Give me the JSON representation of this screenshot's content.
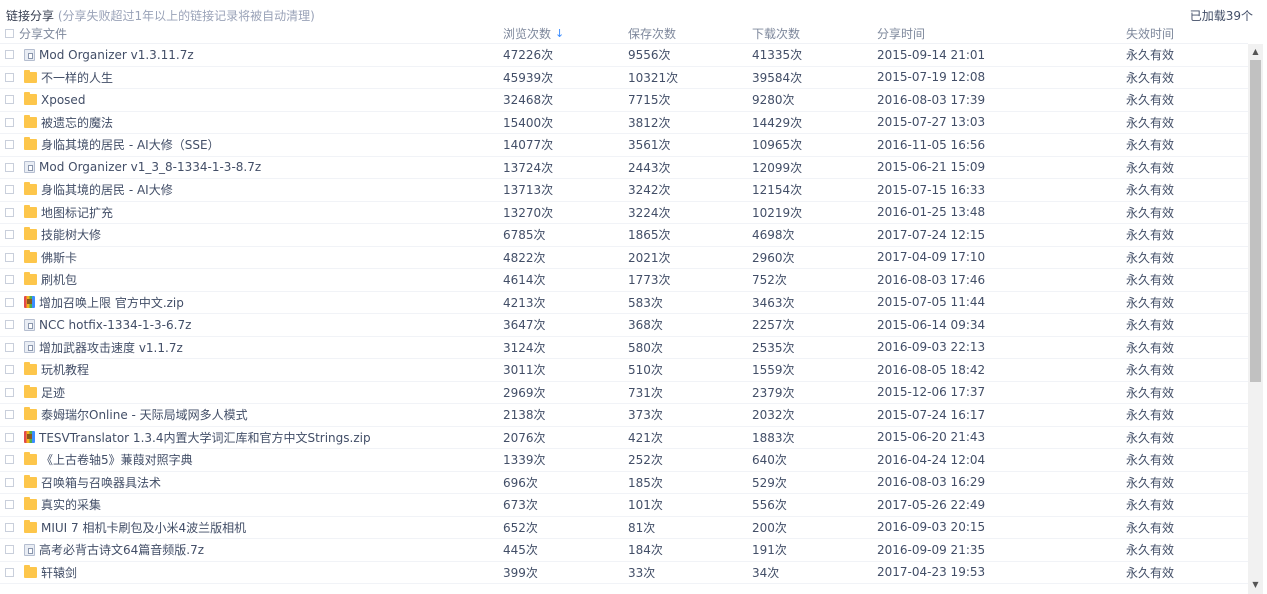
{
  "header": {
    "title": "链接分享",
    "note": "(分享失败超过1年以上的链接记录将被自动清理)",
    "loaded": "已加载39个"
  },
  "columns": {
    "name": "分享文件",
    "views": "浏览次数",
    "views_sort_icon": "arrow-down",
    "saves": "保存次数",
    "downloads": "下载次数",
    "time": "分享时间",
    "status": "失效时间"
  },
  "rows": [
    {
      "icon": "file-7z",
      "name": "Mod Organizer v1.3.11.7z",
      "views": "47226次",
      "saves": "9556次",
      "downloads": "41335次",
      "time": "2015-09-14 21:01",
      "status": "永久有效"
    },
    {
      "icon": "folder",
      "name": "不一样的人生",
      "views": "45939次",
      "saves": "10321次",
      "downloads": "39584次",
      "time": "2015-07-19 12:08",
      "status": "永久有效"
    },
    {
      "icon": "folder",
      "name": "Xposed",
      "views": "32468次",
      "saves": "7715次",
      "downloads": "9280次",
      "time": "2016-08-03 17:39",
      "status": "永久有效"
    },
    {
      "icon": "folder",
      "name": "被遗忘的魔法",
      "views": "15400次",
      "saves": "3812次",
      "downloads": "14429次",
      "time": "2015-07-27 13:03",
      "status": "永久有效"
    },
    {
      "icon": "folder",
      "name": "身临其境的居民 - AI大修（SSE）",
      "views": "14077次",
      "saves": "3561次",
      "downloads": "10965次",
      "time": "2016-11-05 16:56",
      "status": "永久有效"
    },
    {
      "icon": "file-7z",
      "name": "Mod Organizer v1_3_8-1334-1-3-8.7z",
      "views": "13724次",
      "saves": "2443次",
      "downloads": "12099次",
      "time": "2015-06-21 15:09",
      "status": "永久有效"
    },
    {
      "icon": "folder",
      "name": "身临其境的居民 - AI大修",
      "views": "13713次",
      "saves": "3242次",
      "downloads": "12154次",
      "time": "2015-07-15 16:33",
      "status": "永久有效"
    },
    {
      "icon": "folder",
      "name": "地图标记扩充",
      "views": "13270次",
      "saves": "3224次",
      "downloads": "10219次",
      "time": "2016-01-25 13:48",
      "status": "永久有效"
    },
    {
      "icon": "folder",
      "name": "技能树大修",
      "views": "6785次",
      "saves": "1865次",
      "downloads": "4698次",
      "time": "2017-07-24 12:15",
      "status": "永久有效"
    },
    {
      "icon": "folder",
      "name": "佛斯卡",
      "views": "4822次",
      "saves": "2021次",
      "downloads": "2960次",
      "time": "2017-04-09 17:10",
      "status": "永久有效"
    },
    {
      "icon": "folder",
      "name": "刷机包",
      "views": "4614次",
      "saves": "1773次",
      "downloads": "752次",
      "time": "2016-08-03 17:46",
      "status": "永久有效"
    },
    {
      "icon": "zip",
      "name": "增加召唤上限 官方中文.zip",
      "views": "4213次",
      "saves": "583次",
      "downloads": "3463次",
      "time": "2015-07-05 11:44",
      "status": "永久有效"
    },
    {
      "icon": "file-7z",
      "name": "NCC hotfix-1334-1-3-6.7z",
      "views": "3647次",
      "saves": "368次",
      "downloads": "2257次",
      "time": "2015-06-14 09:34",
      "status": "永久有效"
    },
    {
      "icon": "file-7z",
      "name": "增加武器攻击速度 v1.1.7z",
      "views": "3124次",
      "saves": "580次",
      "downloads": "2535次",
      "time": "2016-09-03 22:13",
      "status": "永久有效"
    },
    {
      "icon": "folder",
      "name": "玩机教程",
      "views": "3011次",
      "saves": "510次",
      "downloads": "1559次",
      "time": "2016-08-05 18:42",
      "status": "永久有效"
    },
    {
      "icon": "folder",
      "name": "足迹",
      "views": "2969次",
      "saves": "731次",
      "downloads": "2379次",
      "time": "2015-12-06 17:37",
      "status": "永久有效"
    },
    {
      "icon": "folder",
      "name": "泰姆瑞尔Online - 天际局域网多人模式",
      "views": "2138次",
      "saves": "373次",
      "downloads": "2032次",
      "time": "2015-07-24 16:17",
      "status": "永久有效"
    },
    {
      "icon": "zip",
      "name": "TESVTranslator 1.3.4内置大学词汇库和官方中文Strings.zip",
      "views": "2076次",
      "saves": "421次",
      "downloads": "1883次",
      "time": "2015-06-20 21:43",
      "status": "永久有效"
    },
    {
      "icon": "folder",
      "name": "《上古卷轴5》蒹葭对照字典",
      "views": "1339次",
      "saves": "252次",
      "downloads": "640次",
      "time": "2016-04-24 12:04",
      "status": "永久有效"
    },
    {
      "icon": "folder",
      "name": "召唤箱与召唤器具法术",
      "views": "696次",
      "saves": "185次",
      "downloads": "529次",
      "time": "2016-08-03 16:29",
      "status": "永久有效"
    },
    {
      "icon": "folder",
      "name": "真实的采集",
      "views": "673次",
      "saves": "101次",
      "downloads": "556次",
      "time": "2017-05-26 22:49",
      "status": "永久有效"
    },
    {
      "icon": "folder",
      "name": "MIUI 7 相机卡刷包及小米4波兰版相机",
      "views": "652次",
      "saves": "81次",
      "downloads": "200次",
      "time": "2016-09-03 20:15",
      "status": "永久有效"
    },
    {
      "icon": "file-7z",
      "name": "高考必背古诗文64篇音频版.7z",
      "views": "445次",
      "saves": "184次",
      "downloads": "191次",
      "time": "2016-09-09 21:35",
      "status": "永久有效"
    },
    {
      "icon": "folder",
      "name": "轩辕剑",
      "views": "399次",
      "saves": "33次",
      "downloads": "34次",
      "time": "2017-04-23 19:53",
      "status": "永久有效"
    }
  ],
  "scrollbar": {
    "up_icon": "arrow-up",
    "down_icon": "arrow-down"
  }
}
